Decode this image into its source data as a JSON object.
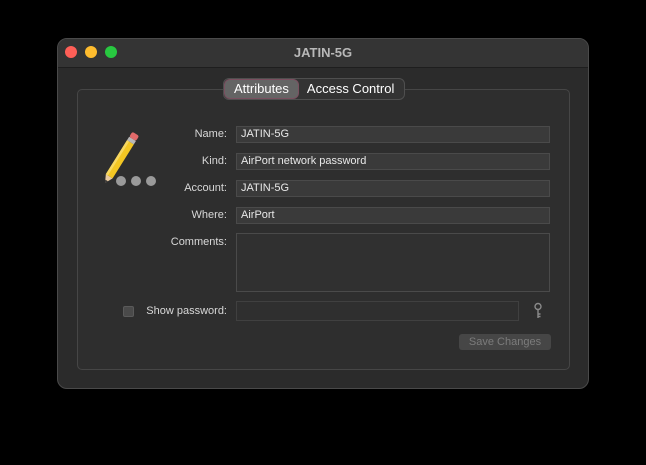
{
  "window": {
    "title": "JATIN-5G"
  },
  "tabs": [
    {
      "label": "Attributes",
      "active": true
    },
    {
      "label": "Access Control",
      "active": false
    }
  ],
  "form": {
    "name": {
      "label": "Name:",
      "value": "JATIN-5G"
    },
    "kind": {
      "label": "Kind:",
      "value": "AirPort network password"
    },
    "account": {
      "label": "Account:",
      "value": "JATIN-5G"
    },
    "where": {
      "label": "Where:",
      "value": "AirPort"
    },
    "comments": {
      "label": "Comments:",
      "value": ""
    },
    "show_password": {
      "label": "Show password:",
      "checked": false,
      "value": ""
    }
  },
  "buttons": {
    "save_label": "Save Changes"
  },
  "icons": {
    "app": "pencil-password-icon",
    "key": "key-icon"
  },
  "colors": {
    "close": "#fe5f57",
    "minimize": "#febc2e",
    "zoom": "#28c840"
  }
}
